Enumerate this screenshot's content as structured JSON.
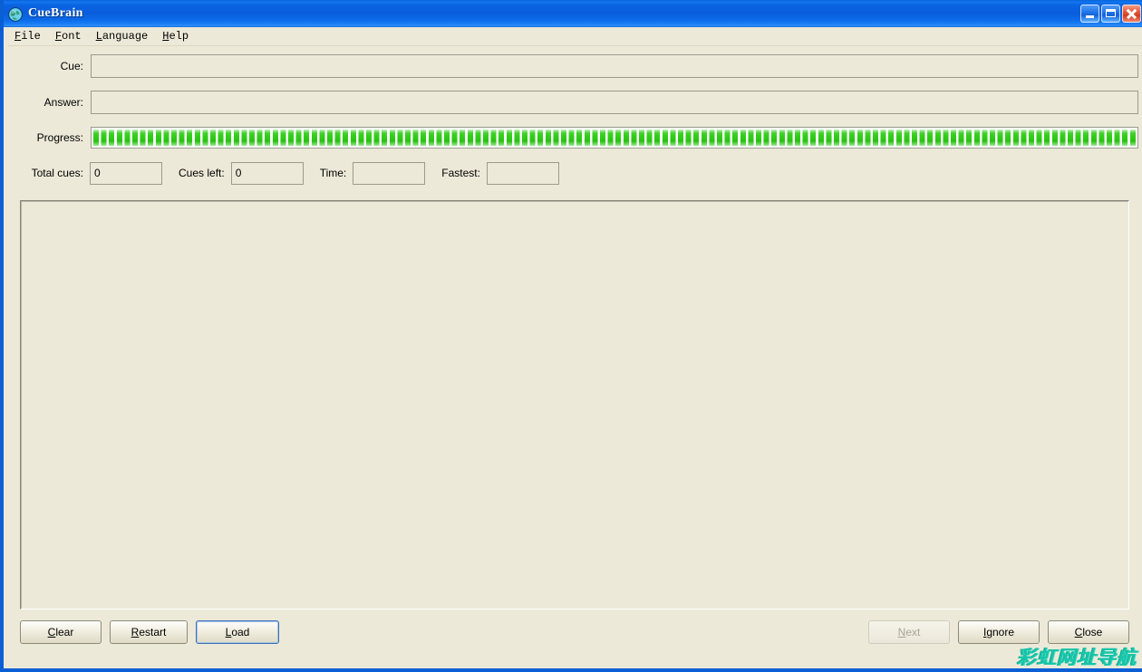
{
  "window": {
    "title": "CueBrain",
    "icon": "globe-icon",
    "controls": {
      "minimize": "Minimize",
      "maximize": "Maximize",
      "close": "Close"
    },
    "frame_color": "#0a5fd4",
    "titlebar_color": "#0a5ddc",
    "dialog_background": "#ece9d8"
  },
  "menubar": {
    "items": [
      {
        "label": "File",
        "accel": "F",
        "rest": "ile"
      },
      {
        "label": "Font",
        "accel": "F",
        "rest": "ont"
      },
      {
        "label": "Language",
        "accel": "L",
        "rest": "anguage"
      },
      {
        "label": "Help",
        "accel": "H",
        "rest": "elp"
      }
    ]
  },
  "form": {
    "cue": {
      "label": "Cue:",
      "value": "",
      "placeholder": ""
    },
    "answer": {
      "label": "Answer:",
      "value": "",
      "placeholder": ""
    },
    "progress": {
      "label": "Progress:",
      "percent": 100,
      "fill_color": "#2ecc16",
      "segmented": true
    }
  },
  "stats": {
    "total_cues": {
      "label": "Total cues:",
      "value": "0"
    },
    "cues_left": {
      "label": "Cues left:",
      "value": "0"
    },
    "time": {
      "label": "Time:",
      "value": ""
    },
    "fastest": {
      "label": "Fastest:",
      "value": ""
    }
  },
  "display": {
    "content": ""
  },
  "buttons": {
    "clear": {
      "label": "Clear",
      "accel": "C",
      "rest": "lear",
      "pre": "",
      "disabled": false,
      "focused": false
    },
    "restart": {
      "label": "Restart",
      "accel": "R",
      "rest": "estart",
      "pre": "",
      "disabled": false,
      "focused": false
    },
    "load": {
      "label": "Load",
      "accel": "L",
      "rest": "oad",
      "pre": "",
      "disabled": false,
      "focused": true
    },
    "next": {
      "label": "Next",
      "accel": "N",
      "rest": "ext",
      "pre": "",
      "disabled": true,
      "focused": false
    },
    "ignore": {
      "label": "Ignore",
      "accel": "I",
      "rest": "gnore",
      "pre": "",
      "disabled": false,
      "focused": false
    },
    "close": {
      "label": "Close",
      "accel": "C",
      "rest": "lose",
      "pre": "",
      "disabled": false,
      "focused": false
    }
  },
  "watermark": {
    "text": "彩虹网址导航",
    "color": "#18c4a8"
  }
}
